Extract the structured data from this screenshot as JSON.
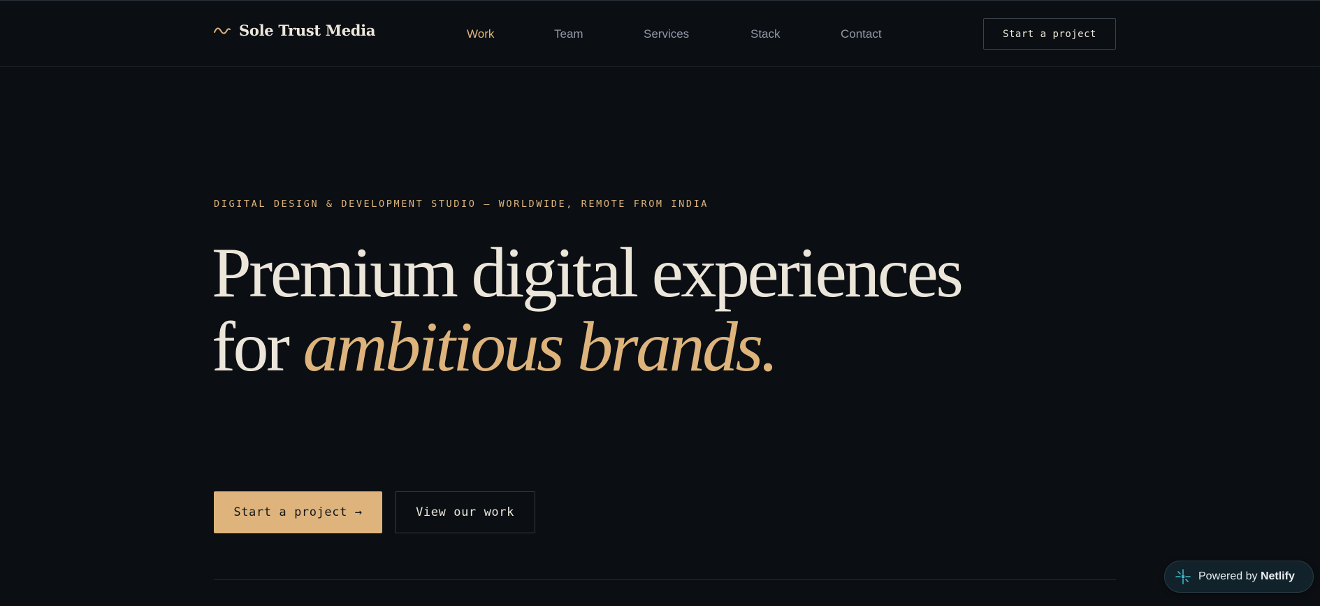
{
  "header": {
    "brand_name": "Sole Trust Media",
    "brand_icon": "wave-icon",
    "nav": [
      {
        "label": "Work",
        "active": true
      },
      {
        "label": "Team",
        "active": false
      },
      {
        "label": "Services",
        "active": false
      },
      {
        "label": "Stack",
        "active": false
      },
      {
        "label": "Contact",
        "active": false
      }
    ],
    "cta_label": "Start a project"
  },
  "hero": {
    "eyebrow": "DIGITAL DESIGN & DEVELOPMENT STUDIO — WORLDWIDE, REMOTE FROM INDIA",
    "headline_part1": "Premium digital experiences for ",
    "headline_accent": "ambitious brands.",
    "primary_button": "Start a project →",
    "secondary_button": "View our work"
  },
  "badge": {
    "prefix": "Powered by ",
    "name": "Netlify",
    "icon": "netlify-icon"
  },
  "colors": {
    "background": "#0b0f13",
    "accent": "#deb47c",
    "text": "#ece6da",
    "muted": "#8f99a6"
  }
}
